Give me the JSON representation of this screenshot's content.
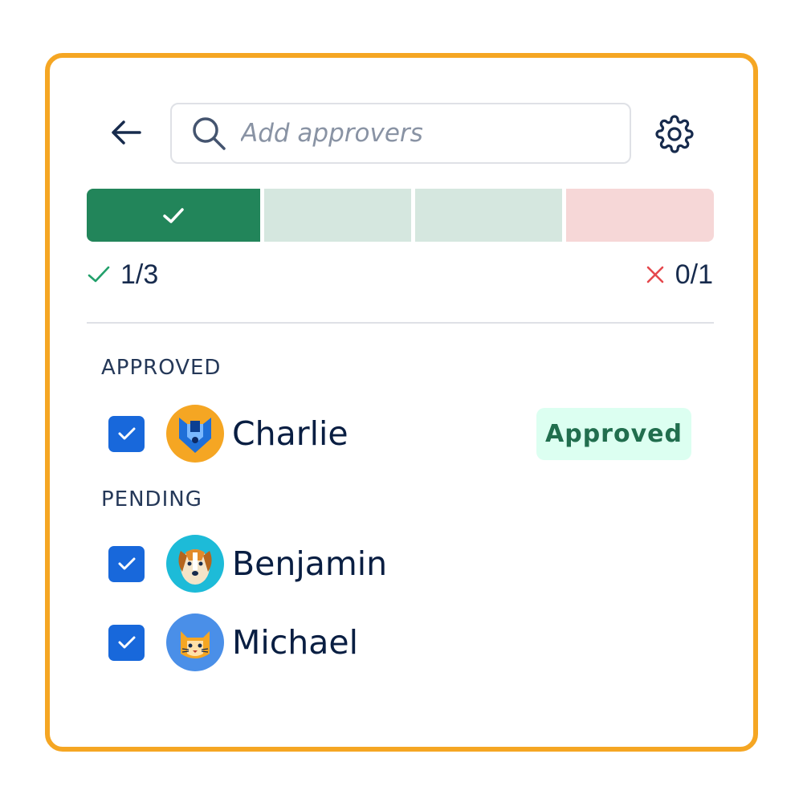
{
  "search": {
    "placeholder": "Add approvers"
  },
  "progress": {
    "approved_count": 1,
    "total_required": 3,
    "rejected_count": 0,
    "reject_limit": 1,
    "approved_text": "1/3",
    "rejected_text": "0/1",
    "colors": {
      "approved": "#22855a",
      "pending": "#d5e7df",
      "rejected": "#f6d7d7"
    }
  },
  "sections": {
    "approved_title": "APPROVED",
    "pending_title": "PENDING"
  },
  "approvers": [
    {
      "name": "Charlie",
      "status": "Approved",
      "checked": true,
      "avatar": "fox-avatar",
      "avatar_bg": "#f5a623"
    },
    {
      "name": "Benjamin",
      "checked": true,
      "avatar": "dog-avatar",
      "avatar_bg": "#1dbbd8"
    },
    {
      "name": "Michael",
      "checked": true,
      "avatar": "cat-avatar",
      "avatar_bg": "#4a8fe8"
    }
  ],
  "icons": {
    "back": "arrow-left-icon",
    "search": "search-icon",
    "settings": "gear-icon",
    "check": "check-icon",
    "cross": "cross-icon"
  },
  "accent": "#f5a623"
}
